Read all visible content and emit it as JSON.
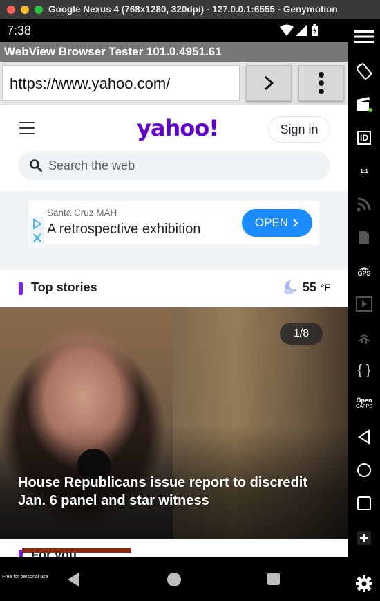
{
  "window": {
    "title": "Google Nexus 4 (768x1280, 320dpi) - 127.0.0.1:6555 - Genymotion"
  },
  "statusbar": {
    "time": "7:38"
  },
  "app": {
    "title": "WebView Browser Tester 101.0.4951.61",
    "url": "https://www.yahoo.com/"
  },
  "yahoo": {
    "logo": "yahoo!",
    "sign_in": "Sign in",
    "search_placeholder": "Search the web"
  },
  "ad": {
    "sponsor": "Santa Cruz MAH",
    "headline": "A retrospective exhibition",
    "cta": "OPEN"
  },
  "top_stories": {
    "title": "Top stories",
    "temperature": "55",
    "unit": "°F",
    "weather_icon": "moon-cloud-icon"
  },
  "story": {
    "counter": "1/8",
    "headline": "House Republicans issue report to discredit Jan. 6 panel and star witness"
  },
  "for_you": {
    "title": "For you"
  },
  "footer": {
    "note": "Free for personal use"
  },
  "side_panel": {
    "labels": {
      "id": "ID",
      "scale": "1:1",
      "gps": "GPS",
      "open": "Open",
      "gapps": "GAPPS"
    }
  },
  "colors": {
    "yahoo_purple": "#6001d2",
    "section_accent": "#7e1fff",
    "open_button": "#1a8cff"
  }
}
